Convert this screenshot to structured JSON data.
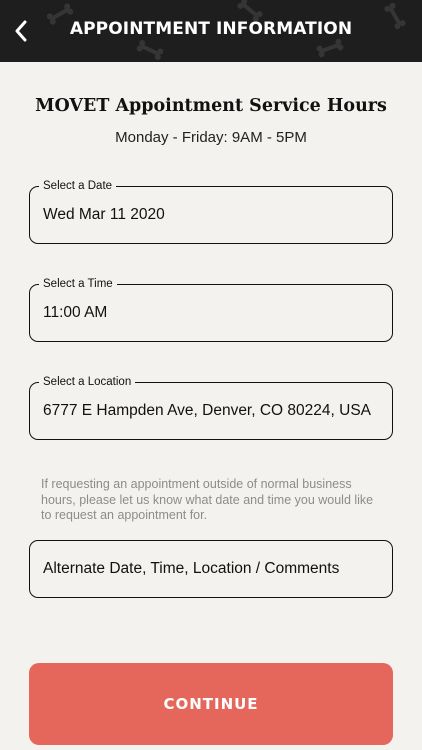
{
  "header": {
    "title": "APPOINTMENT INFORMATION",
    "back_icon": "chevron-left-icon"
  },
  "service": {
    "heading": "MOVET Appointment Service Hours",
    "hours": "Monday - Friday: 9AM - 5PM"
  },
  "fields": {
    "date": {
      "label": "Select a Date",
      "value": "Wed Mar 11 2020"
    },
    "time": {
      "label": "Select a Time",
      "value": "11:00 AM"
    },
    "location": {
      "label": "Select a Location",
      "value": "6777 E Hampden Ave, Denver, CO 80224, USA"
    }
  },
  "note": "If requesting an appointment outside of normal business hours, please let us know what date and time you would like to request an appointment for.",
  "comments": {
    "placeholder": "Alternate Date, Time, Location / Comments"
  },
  "continue_label": "CONTINUE",
  "colors": {
    "header_bg": "#1e1e1e",
    "page_bg": "#f4f2ef",
    "accent": "#e5675b",
    "note_text": "#8c8c8c"
  }
}
